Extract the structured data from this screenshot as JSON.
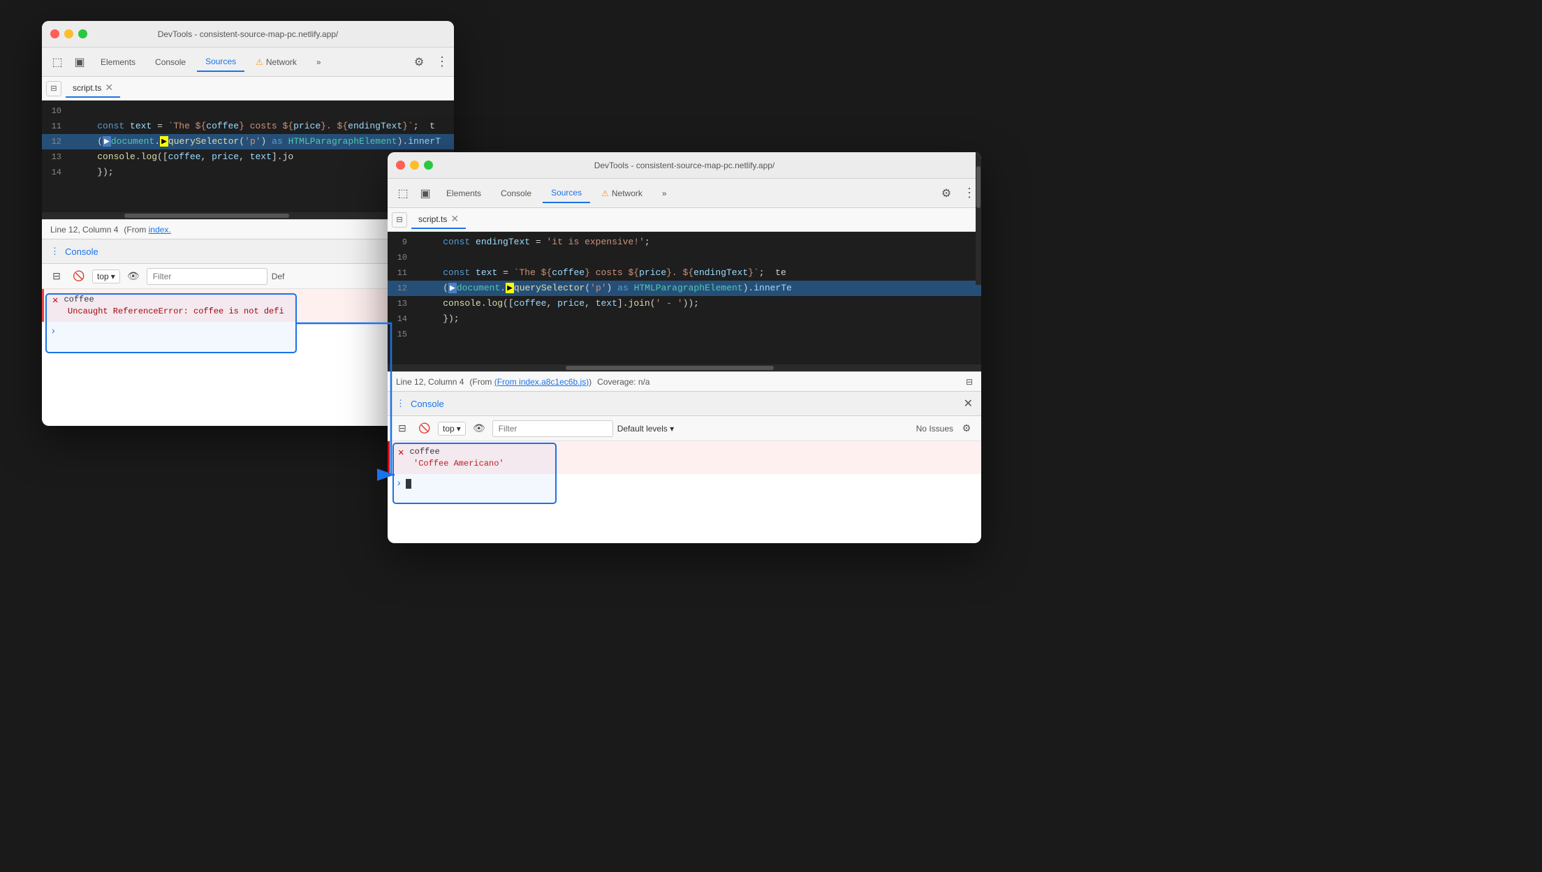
{
  "window_back": {
    "title": "DevTools - consistent-source-map-pc.netlify.app/",
    "tabs": [
      "Elements",
      "Console",
      "Sources",
      "Network"
    ],
    "active_tab": "Sources",
    "file_tab": "script.ts",
    "code_lines": [
      {
        "num": 10,
        "content": "",
        "active": false
      },
      {
        "num": 11,
        "content": "    const text = `The ${coffee} costs ${price}. ${endingText}`;  t",
        "active": false
      },
      {
        "num": 12,
        "content": "    (▶document.▶querySelector('p') as HTMLParagraphElement).innerT",
        "active": true
      },
      {
        "num": 13,
        "content": "    console.log([coffee, price, text].jo",
        "active": false
      },
      {
        "num": 14,
        "content": "    });",
        "active": false
      }
    ],
    "status_line": "Line 12, Column 4",
    "status_from": "(From index.",
    "console_label": "Console",
    "console_toolbar": {
      "top_label": "top",
      "filter_placeholder": "Filter",
      "default_label": "Def"
    },
    "error": {
      "variable": "coffee",
      "message": "Uncaught ReferenceError: coffee is not defi"
    }
  },
  "window_front": {
    "title": "DevTools - consistent-source-map-pc.netlify.app/",
    "tabs": [
      "Elements",
      "Console",
      "Sources",
      "Network"
    ],
    "active_tab": "Sources",
    "file_tab": "script.ts",
    "code_lines": [
      {
        "num": 9,
        "content": "    const endingText = 'it is expensive!';",
        "active": false
      },
      {
        "num": 10,
        "content": "",
        "active": false
      },
      {
        "num": 11,
        "content": "    const text = `The ${coffee} costs ${price}. ${endingText}`;  te",
        "active": false
      },
      {
        "num": 12,
        "content": "    (▶document.▶querySelector('p') as HTMLParagraphElement).innerTe",
        "active": true
      },
      {
        "num": 13,
        "content": "    console.log([coffee, price, text].join(' - '));",
        "active": false
      },
      {
        "num": 14,
        "content": "    });",
        "active": false
      },
      {
        "num": 15,
        "content": "",
        "active": false
      }
    ],
    "status_line": "Line 12, Column 4",
    "status_from": "(From index.a8c1ec6b.js)",
    "status_coverage": "Coverage: n/a",
    "console_label": "Console",
    "console_toolbar": {
      "top_label": "top",
      "filter_placeholder": "Filter",
      "default_levels": "Default levels",
      "no_issues": "No Issues"
    },
    "error": {
      "variable": "coffee",
      "value": "'Coffee Americano'"
    }
  },
  "icons": {
    "close": "✕",
    "warning": "⚠",
    "gear": "⚙",
    "three_dots": "⋮",
    "chevron_down": "▾",
    "eye": "👁",
    "block": "🚫",
    "expand_sidebar": "⊞",
    "sidebar": "⊟",
    "more": "»",
    "prompt": ">"
  }
}
